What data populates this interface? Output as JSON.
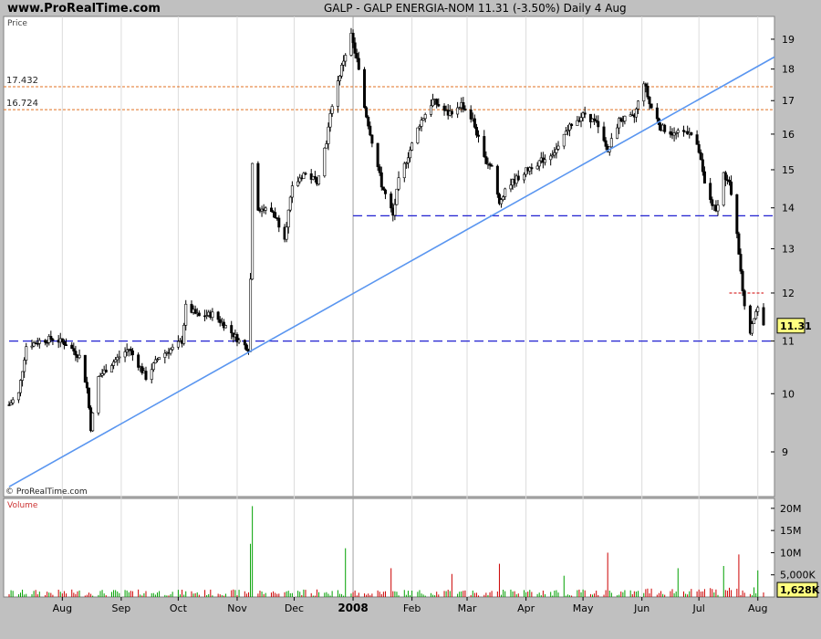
{
  "header": {
    "site": "www.ProRealTime.com",
    "title": "GALP - GALP ENERGIA-NOM    11.31 (-3.50%)    Daily  4 Aug"
  },
  "price_panel": {
    "label": "Price",
    "watermark": "© ProRealTime.com"
  },
  "volume_panel": {
    "label": "Volume"
  },
  "colors": {
    "up": "#00a000",
    "down": "#cc0000",
    "trend": "#5a96f0",
    "support": "#2020d0",
    "level": "#e07020",
    "resistance": "#d00000"
  },
  "chart_data": [
    {
      "type": "candlestick",
      "title": "GALP - GALP ENERGIA-NOM",
      "ylabel": "Price",
      "y_scale": "log",
      "ylim": [
        8.3,
        19.8
      ],
      "yticks": [
        9,
        10,
        11,
        12,
        13,
        14,
        15,
        16,
        17,
        18,
        19
      ],
      "xlim": [
        "2007-07-04",
        "2008-08-04"
      ],
      "xticks": [
        {
          "date": "2007-08-01",
          "label": "Aug"
        },
        {
          "date": "2007-09-01",
          "label": "Sep"
        },
        {
          "date": "2007-10-01",
          "label": "Oct"
        },
        {
          "date": "2007-11-01",
          "label": "Nov"
        },
        {
          "date": "2007-12-01",
          "label": "Dec"
        },
        {
          "date": "2008-01-01",
          "label": "2008",
          "bold": true
        },
        {
          "date": "2008-02-01",
          "label": "Feb"
        },
        {
          "date": "2008-03-01",
          "label": "Mar"
        },
        {
          "date": "2008-04-01",
          "label": "Apr"
        },
        {
          "date": "2008-05-01",
          "label": "May"
        },
        {
          "date": "2008-06-01",
          "label": "Jun"
        },
        {
          "date": "2008-07-01",
          "label": "Jul"
        },
        {
          "date": "2008-08-01",
          "label": "Aug"
        }
      ],
      "last_price": "11.31",
      "levels": [
        {
          "label": "17.432",
          "value": 17.432
        },
        {
          "label": "16.724",
          "value": 16.724
        }
      ],
      "support_lines": [
        {
          "value": 11.0,
          "from": "2007-07-04",
          "to": "2008-08-04"
        },
        {
          "value": 13.8,
          "from": "2008-01-01",
          "to": "2008-08-04"
        }
      ],
      "resistance_lines": [
        {
          "value": 12.0,
          "from": "2008-07-17",
          "to": "2008-08-04"
        }
      ],
      "trendline": {
        "from": {
          "date": "2007-07-04",
          "value": 8.45
        },
        "to": {
          "date": "2008-08-04",
          "value": 18.4
        }
      },
      "closes_path": [
        {
          "date": "2007-07-04",
          "value": 9.8
        },
        {
          "date": "2007-07-09",
          "value": 10.0
        },
        {
          "date": "2007-07-13",
          "value": 10.9
        },
        {
          "date": "2007-07-20",
          "value": 11.0
        },
        {
          "date": "2007-07-27",
          "value": 11.05
        },
        {
          "date": "2007-08-03",
          "value": 10.95
        },
        {
          "date": "2007-08-10",
          "value": 10.7
        },
        {
          "date": "2007-08-14",
          "value": 10.1
        },
        {
          "date": "2007-08-16",
          "value": 9.4
        },
        {
          "date": "2007-08-20",
          "value": 10.3
        },
        {
          "date": "2007-08-28",
          "value": 10.6
        },
        {
          "date": "2007-09-05",
          "value": 10.85
        },
        {
          "date": "2007-09-14",
          "value": 10.3
        },
        {
          "date": "2007-09-21",
          "value": 10.7
        },
        {
          "date": "2007-09-28",
          "value": 10.85
        },
        {
          "date": "2007-10-03",
          "value": 11.0
        },
        {
          "date": "2007-10-05",
          "value": 11.7
        },
        {
          "date": "2007-10-12",
          "value": 11.5
        },
        {
          "date": "2007-10-19",
          "value": 11.55
        },
        {
          "date": "2007-10-26",
          "value": 11.3
        },
        {
          "date": "2007-11-02",
          "value": 11.0
        },
        {
          "date": "2007-11-07",
          "value": 10.85
        },
        {
          "date": "2007-11-08",
          "value": 12.3
        },
        {
          "date": "2007-11-09",
          "value": 15.2
        },
        {
          "date": "2007-11-12",
          "value": 14.0
        },
        {
          "date": "2007-11-20",
          "value": 13.9
        },
        {
          "date": "2007-11-26",
          "value": 13.3
        },
        {
          "date": "2007-11-30",
          "value": 14.5
        },
        {
          "date": "2007-12-06",
          "value": 14.9
        },
        {
          "date": "2007-12-13",
          "value": 14.7
        },
        {
          "date": "2007-12-18",
          "value": 15.8
        },
        {
          "date": "2007-12-21",
          "value": 16.9
        },
        {
          "date": "2007-12-27",
          "value": 18.3
        },
        {
          "date": "2007-12-31",
          "value": 19.1
        },
        {
          "date": "2008-01-03",
          "value": 18.3
        },
        {
          "date": "2008-01-07",
          "value": 16.8
        },
        {
          "date": "2008-01-11",
          "value": 15.8
        },
        {
          "date": "2008-01-16",
          "value": 14.6
        },
        {
          "date": "2008-01-22",
          "value": 13.8
        },
        {
          "date": "2008-01-25",
          "value": 14.7
        },
        {
          "date": "2008-01-30",
          "value": 15.4
        },
        {
          "date": "2008-02-05",
          "value": 16.3
        },
        {
          "date": "2008-02-12",
          "value": 17.0
        },
        {
          "date": "2008-02-20",
          "value": 16.6
        },
        {
          "date": "2008-02-27",
          "value": 16.9
        },
        {
          "date": "2008-03-04",
          "value": 16.4
        },
        {
          "date": "2008-03-10",
          "value": 15.3
        },
        {
          "date": "2008-03-14",
          "value": 15.1
        },
        {
          "date": "2008-03-18",
          "value": 14.1
        },
        {
          "date": "2008-03-21",
          "value": 14.5
        },
        {
          "date": "2008-03-28",
          "value": 14.8
        },
        {
          "date": "2008-04-04",
          "value": 15.1
        },
        {
          "date": "2008-04-11",
          "value": 15.3
        },
        {
          "date": "2008-04-18",
          "value": 15.6
        },
        {
          "date": "2008-04-25",
          "value": 16.3
        },
        {
          "date": "2008-05-02",
          "value": 16.6
        },
        {
          "date": "2008-05-08",
          "value": 16.3
        },
        {
          "date": "2008-05-14",
          "value": 15.5
        },
        {
          "date": "2008-05-20",
          "value": 16.4
        },
        {
          "date": "2008-05-28",
          "value": 16.5
        },
        {
          "date": "2008-06-02",
          "value": 17.6
        },
        {
          "date": "2008-06-05",
          "value": 16.9
        },
        {
          "date": "2008-06-11",
          "value": 16.2
        },
        {
          "date": "2008-06-18",
          "value": 16.0
        },
        {
          "date": "2008-06-26",
          "value": 16.1
        },
        {
          "date": "2008-07-01",
          "value": 15.5
        },
        {
          "date": "2008-07-04",
          "value": 14.6
        },
        {
          "date": "2008-07-08",
          "value": 14.1
        },
        {
          "date": "2008-07-10",
          "value": 13.9
        },
        {
          "date": "2008-07-14",
          "value": 14.9
        },
        {
          "date": "2008-07-17",
          "value": 14.6
        },
        {
          "date": "2008-07-21",
          "value": 13.4
        },
        {
          "date": "2008-07-24",
          "value": 12.0
        },
        {
          "date": "2008-07-28",
          "value": 11.1
        },
        {
          "date": "2008-07-30",
          "value": 11.5
        },
        {
          "date": "2008-08-01",
          "value": 11.7
        },
        {
          "date": "2008-08-04",
          "value": 11.31
        }
      ]
    },
    {
      "type": "bar",
      "title": "Volume",
      "ylim": [
        0,
        21000000
      ],
      "yticks": [
        {
          "value": 5000000,
          "label": "5,000K"
        },
        {
          "value": 10000000,
          "label": "10M"
        },
        {
          "value": 15000000,
          "label": "15M"
        },
        {
          "value": 20000000,
          "label": "20M"
        }
      ],
      "last_volume": "1,628K",
      "spikes": [
        {
          "date": "2007-11-09",
          "value": 20500000
        },
        {
          "date": "2007-11-08",
          "value": 12000000
        },
        {
          "date": "2007-12-28",
          "value": 11000000
        },
        {
          "date": "2008-01-21",
          "value": 6500000
        },
        {
          "date": "2008-02-22",
          "value": 5200000
        },
        {
          "date": "2008-03-18",
          "value": 7500000
        },
        {
          "date": "2008-04-21",
          "value": 4800000
        },
        {
          "date": "2008-05-14",
          "value": 10000000
        },
        {
          "date": "2008-06-20",
          "value": 6500000
        },
        {
          "date": "2008-07-14",
          "value": 7000000
        },
        {
          "date": "2008-07-22",
          "value": 9600000
        },
        {
          "date": "2008-08-01",
          "value": 6000000
        }
      ]
    }
  ]
}
